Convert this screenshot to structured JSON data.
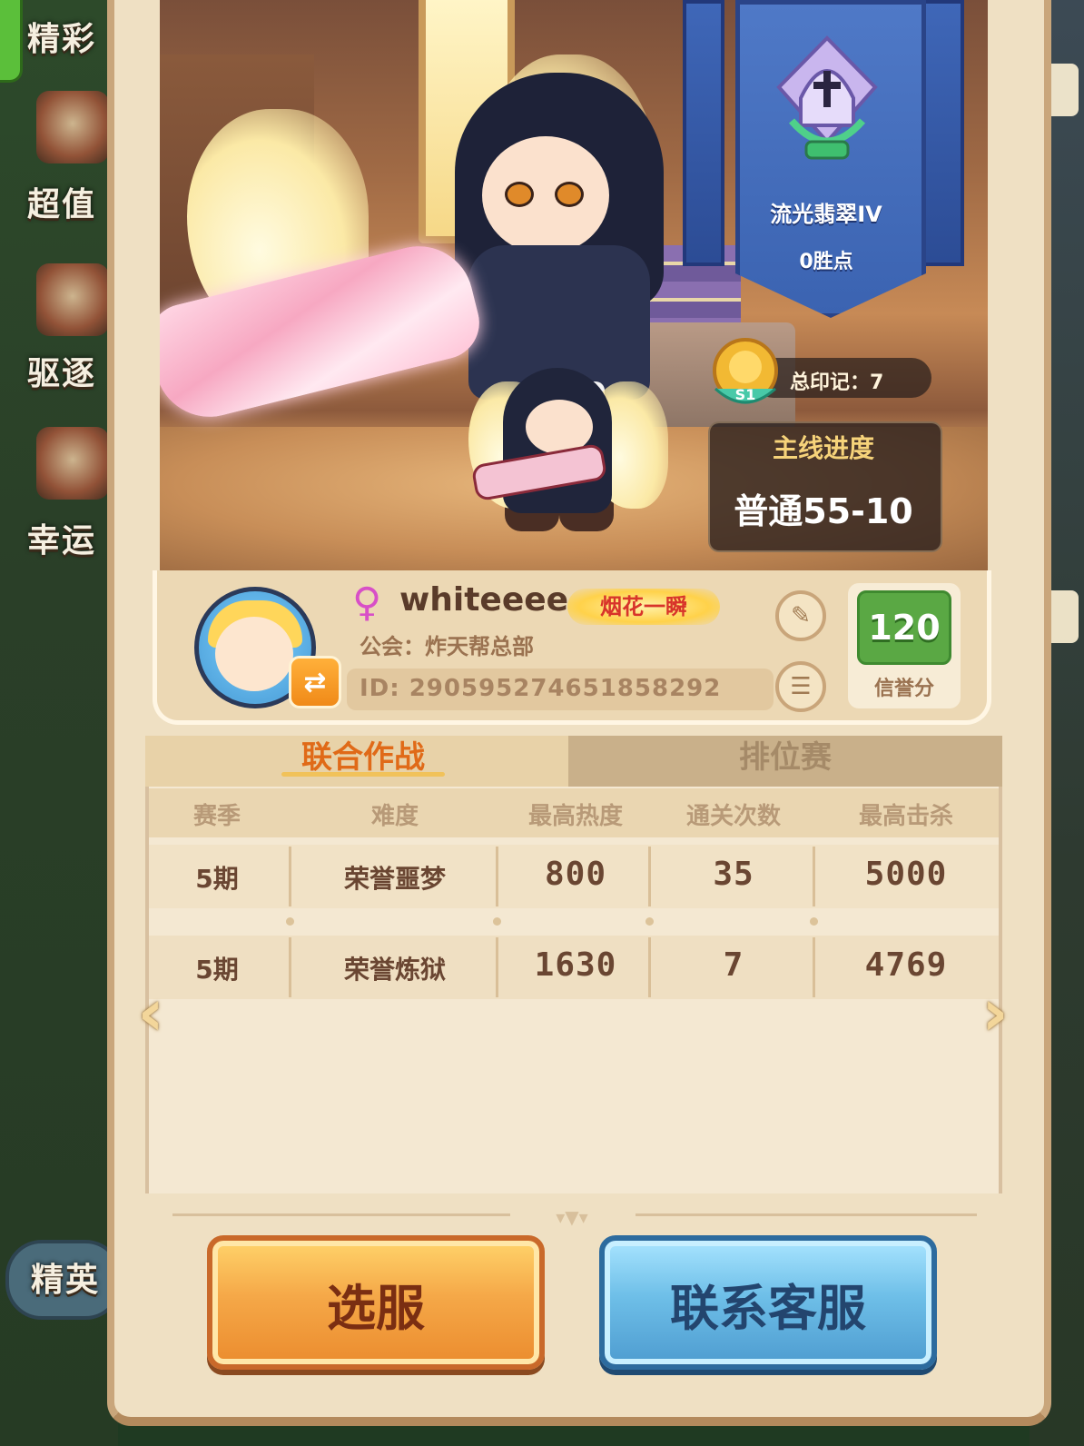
{
  "background": {
    "left_menu": [
      "精彩",
      "超值",
      "驱逐",
      "幸运",
      "精英"
    ],
    "colors": {
      "grass": "#2a3f28"
    }
  },
  "hero_scene": {
    "rank": {
      "name": "流光翡翠IV",
      "points": "0胜点",
      "emblem_icon": "helmet-crest-icon"
    },
    "marks": {
      "label": "总印记：7",
      "badge_text": "S1"
    },
    "main_progress": {
      "title": "主线进度",
      "value": "普通55-10"
    }
  },
  "profile": {
    "gender_icon": "female-icon",
    "username": "whiteeee",
    "title_badge": "烟花一瞬",
    "guild": "公会：炸天帮总部",
    "id": "ID: 2905952746518582​92",
    "credit": {
      "value": "120",
      "label": "信誉分"
    }
  },
  "tabs": [
    {
      "label": "联合作战",
      "active": true
    },
    {
      "label": "排位赛",
      "active": false
    }
  ],
  "table": {
    "headers": [
      "赛季",
      "难度",
      "最高热度",
      "通关次数",
      "最高击杀"
    ],
    "rows": [
      [
        "5期",
        "荣誉噩梦",
        "800",
        "35",
        "5000"
      ],
      [
        "5期",
        "荣誉炼狱",
        "1630",
        "7",
        "4769"
      ]
    ]
  },
  "buttons": {
    "select_server": "选服",
    "contact_support": "联系客服"
  },
  "accent_colors": {
    "orange": "#eb8c2e",
    "blue": "#4e9cd0",
    "credit_green": "#5aa844",
    "tab_active": "#e06a18"
  }
}
